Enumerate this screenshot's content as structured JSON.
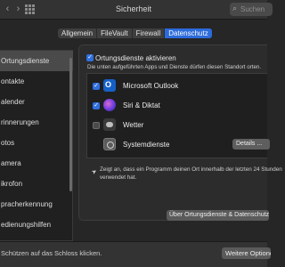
{
  "window": {
    "title": "Sicherheit",
    "back_glyph": "‹",
    "forward_glyph": "›",
    "search_placeholder": "Suchen"
  },
  "tabs": [
    {
      "label": "Allgemein",
      "active": false
    },
    {
      "label": "FileVault",
      "active": false
    },
    {
      "label": "Firewall",
      "active": false
    },
    {
      "label": "Datenschutz",
      "active": true
    }
  ],
  "sidebar": {
    "items": [
      {
        "label": "Ortungsdienste",
        "selected": true
      },
      {
        "label": "ontakte",
        "selected": false
      },
      {
        "label": "alender",
        "selected": false
      },
      {
        "label": "rinnerungen",
        "selected": false
      },
      {
        "label": "otos",
        "selected": false
      },
      {
        "label": "amera",
        "selected": false
      },
      {
        "label": "ikrofon",
        "selected": false
      },
      {
        "label": "pracherkennung",
        "selected": false
      },
      {
        "label": "edienungshilfen",
        "selected": false
      }
    ]
  },
  "location": {
    "enable_label": "Ortungsdienste aktivieren",
    "enabled": true,
    "description": "Die unten aufgeführten Apps und Dienste dürfen diesen Standort orten.",
    "apps": [
      {
        "name": "Microsoft Outlook",
        "checked": true,
        "icon": "outlook-icon"
      },
      {
        "name": "Siri & Diktat",
        "checked": true,
        "icon": "siri-icon"
      },
      {
        "name": "Wetter",
        "checked": false,
        "icon": "weather-icon"
      },
      {
        "name": "Systemdienste",
        "checked": null,
        "icon": "system-services-icon"
      }
    ],
    "details_button": "Details ...",
    "note_line1": "Zeigt an, dass ein Programm deinen Ort innerhalb der letzten 24 Stunden",
    "note_line2": "verwendet hat.",
    "about_button": "Über Ortungsdienste & Datenschutz"
  },
  "footer": {
    "lock_text": "Schützen auf das Schloss klicken.",
    "more_button": "Weitere Optionen"
  },
  "colors": {
    "accent": "#2c6bdb",
    "checkbox": "#2f6fe0",
    "background": "#262626"
  }
}
